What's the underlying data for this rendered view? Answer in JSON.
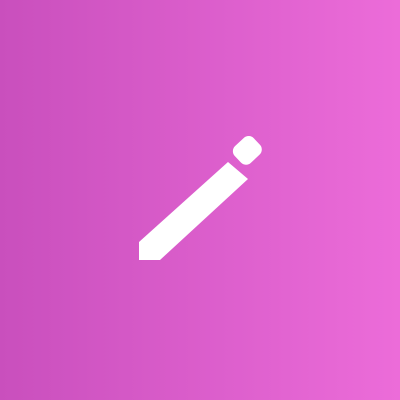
{
  "tile": {
    "background_start": "#c94fbd",
    "background_end": "#ec6cd9",
    "icon": "pencil-icon",
    "icon_color": "#ffffff"
  }
}
